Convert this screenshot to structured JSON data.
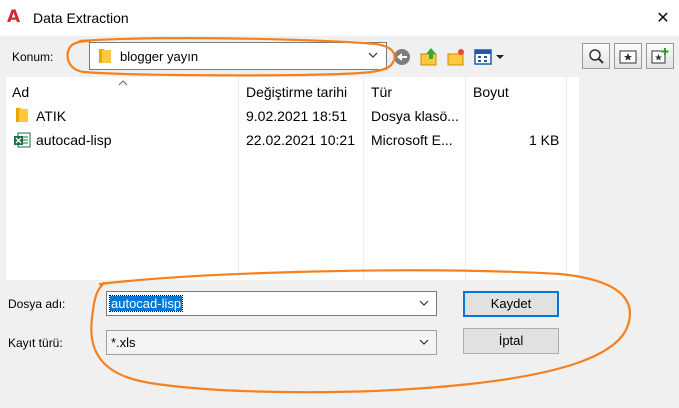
{
  "window": {
    "title": "Data Extraction",
    "app_icon_glyph": "A",
    "close_glyph": "✕"
  },
  "location": {
    "label": "Konum:",
    "value": "blogger yayın"
  },
  "toolbar": {
    "icons": [
      "back-icon",
      "up-folder-icon",
      "new-folder-icon",
      "views-menu-icon",
      "search-web-icon",
      "favorites-icon",
      "add-favorite-icon"
    ]
  },
  "file_list": {
    "columns": [
      "Ad",
      "Değiştirme tarihi",
      "Tür",
      "Boyut"
    ],
    "rows": [
      {
        "name": "ATIK",
        "modified": "9.02.2021 18:51",
        "type": "Dosya klasö...",
        "size": ""
      },
      {
        "name": "autocad-lisp",
        "modified": "22.02.2021 10:21",
        "type": "Microsoft E...",
        "size": "1 KB"
      }
    ]
  },
  "form": {
    "filename_label": "Dosya adı:",
    "filename_value": "autocad-lisp",
    "filetype_label": "Kayıt türü:",
    "filetype_value": "*.xls",
    "save_label": "Kaydet",
    "cancel_label": "İptal"
  },
  "colors": {
    "annotation": "#f5801f",
    "selection": "#0078d7",
    "app_red": "#d9262e"
  }
}
